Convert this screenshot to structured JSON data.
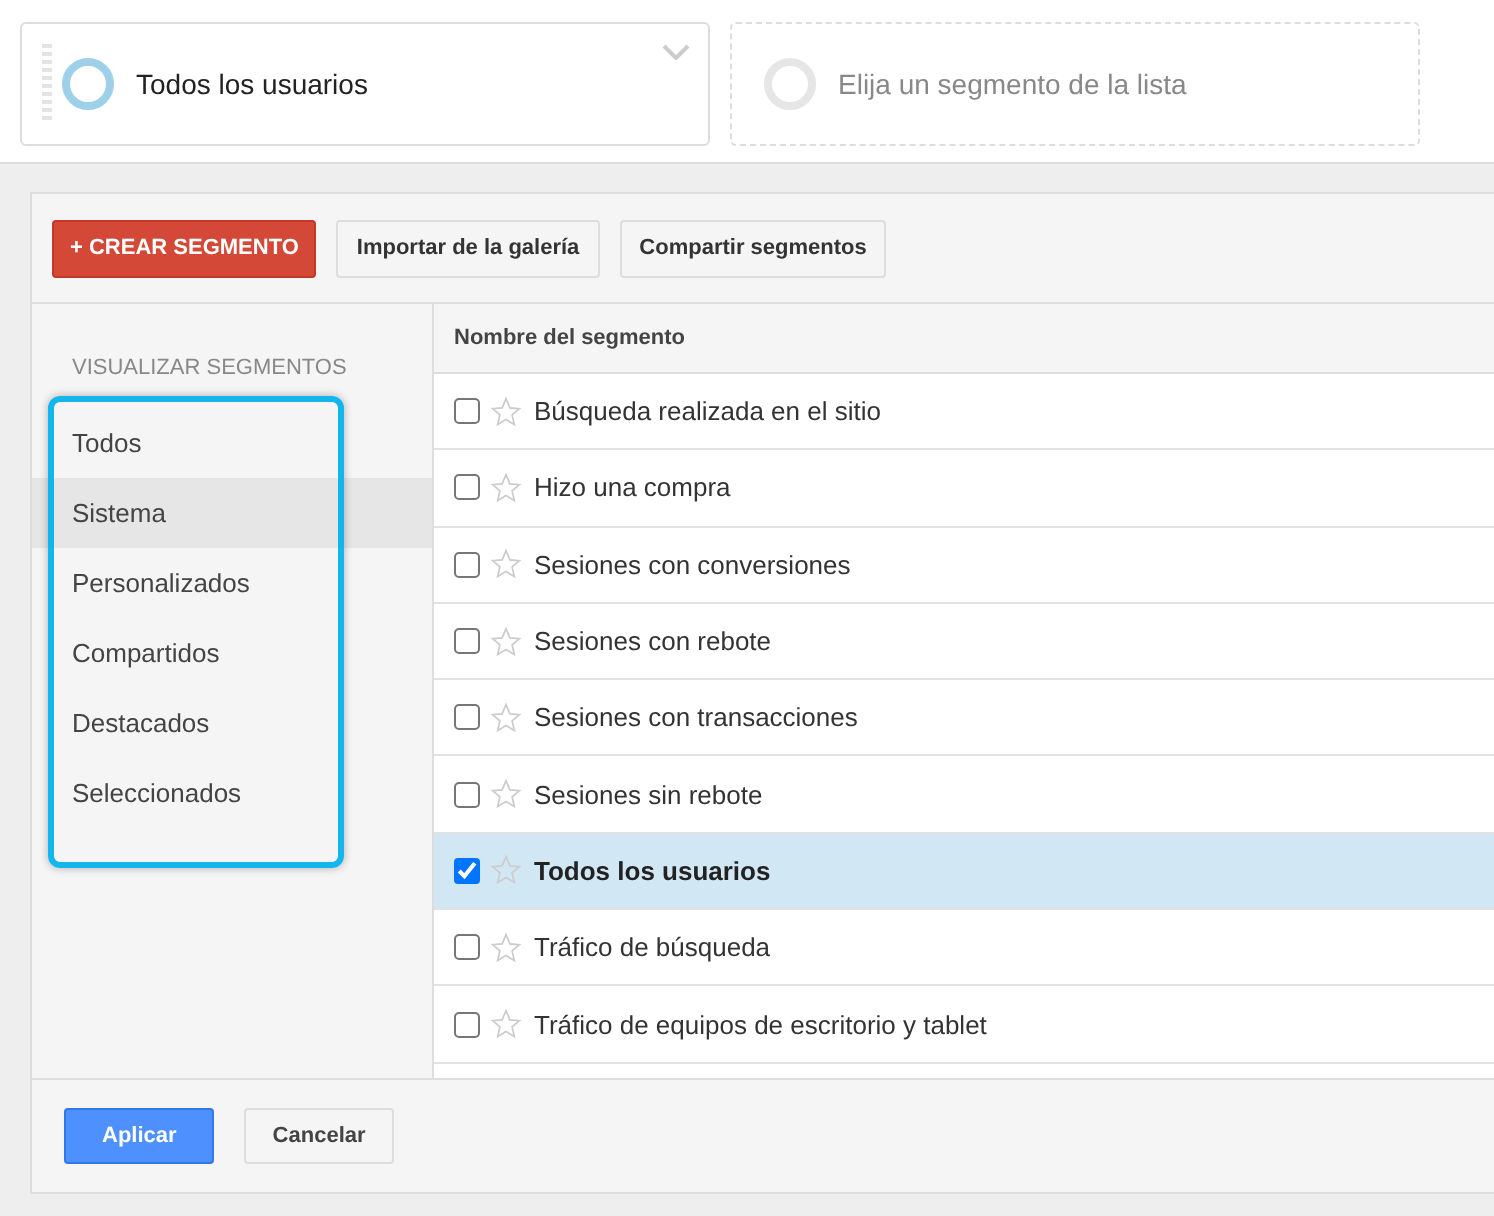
{
  "segment_slots": [
    {
      "kind": "filled",
      "label": "Todos los usuarios"
    },
    {
      "kind": "empty",
      "label": "Elija un segmento de la lista"
    }
  ],
  "toolbar": {
    "create_button": "+ CREAR SEGMENTO",
    "buttons": [
      "Importar de la galería",
      "Compartir segmentos"
    ]
  },
  "sidebar": {
    "heading": "VISUALIZAR SEGMENTOS",
    "highlighted": true,
    "items": [
      {
        "label": "Todos",
        "selected": false
      },
      {
        "label": "Sistema",
        "selected": true
      },
      {
        "label": "Personalizados",
        "selected": false
      },
      {
        "label": "Compartidos",
        "selected": false
      },
      {
        "label": "Destacados",
        "selected": false
      },
      {
        "label": "Seleccionados",
        "selected": false
      }
    ]
  },
  "table": {
    "column": "Nombre del segmento",
    "rows": [
      {
        "name": "Búsqueda realizada en el sitio",
        "checked": false
      },
      {
        "name": "Hizo una compra",
        "checked": false
      },
      {
        "name": "Sesiones con conversiones",
        "checked": false
      },
      {
        "name": "Sesiones con rebote",
        "checked": false
      },
      {
        "name": "Sesiones con transacciones",
        "checked": false
      },
      {
        "name": "Sesiones sin rebote",
        "checked": false
      },
      {
        "name": "Todos los usuarios",
        "checked": true
      },
      {
        "name": "Tráfico de búsqueda",
        "checked": false
      },
      {
        "name": "Tráfico de equipos de escritorio y tablet",
        "checked": false
      }
    ]
  },
  "footer": {
    "apply": "Aplicar",
    "cancel": "Cancelar"
  }
}
